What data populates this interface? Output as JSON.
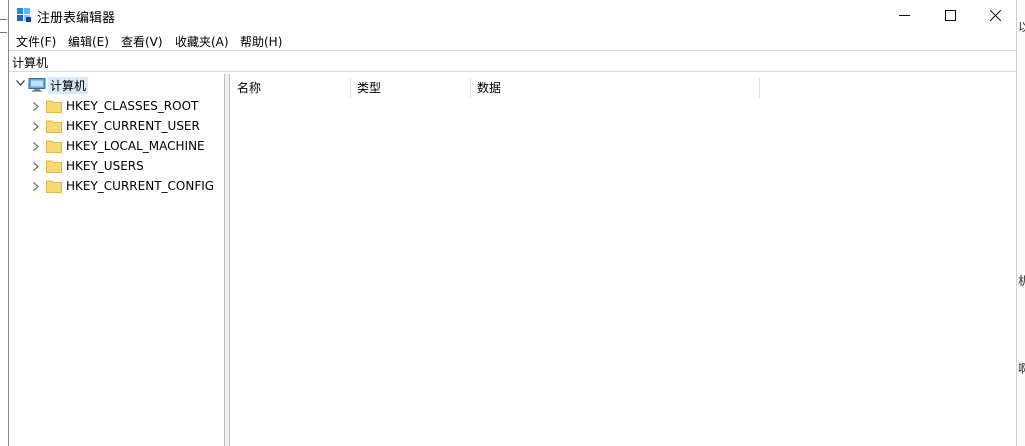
{
  "window": {
    "title": "注册表编辑器",
    "accent_color": "#0078d7"
  },
  "menu": {
    "items": [
      "文件(F)",
      "编辑(E)",
      "查看(V)",
      "收藏夹(A)",
      "帮助(H)"
    ]
  },
  "address": {
    "path": "计算机"
  },
  "tree": {
    "root": {
      "label": "计算机",
      "icon": "computer-icon",
      "expanded": true
    },
    "items": [
      {
        "label": "HKEY_CLASSES_ROOT",
        "icon": "folder-icon"
      },
      {
        "label": "HKEY_CURRENT_USER",
        "icon": "folder-icon"
      },
      {
        "label": "HKEY_LOCAL_MACHINE",
        "icon": "folder-icon"
      },
      {
        "label": "HKEY_USERS",
        "icon": "folder-icon"
      },
      {
        "label": "HKEY_CURRENT_CONFIG",
        "icon": "folder-icon"
      }
    ]
  },
  "list": {
    "columns": [
      "名称",
      "类型",
      "数据"
    ]
  },
  "background": {
    "right_edge_glyphs": [
      "以",
      "机",
      "啊"
    ]
  }
}
